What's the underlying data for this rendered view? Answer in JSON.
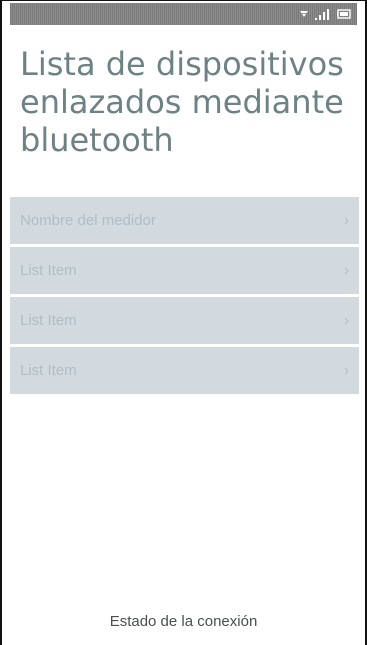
{
  "header": {
    "title": "Lista de dispositivos enlazados mediante bluetooth"
  },
  "status_bar": {
    "icons": [
      "wifi-icon",
      "signal-icon",
      "battery-icon"
    ]
  },
  "devices": {
    "items": [
      {
        "label": "Nombre del medidor",
        "chevron": "›"
      },
      {
        "label": "List Item",
        "chevron": "›"
      },
      {
        "label": "List Item",
        "chevron": "›"
      },
      {
        "label": "List Item",
        "chevron": "›"
      }
    ]
  },
  "footer": {
    "connection_status": "Estado de la conexión"
  },
  "colors": {
    "title": "#6e8286",
    "list_background": "#d3dadf",
    "list_text": "#b0bdc4",
    "status_bar": "#808080"
  }
}
